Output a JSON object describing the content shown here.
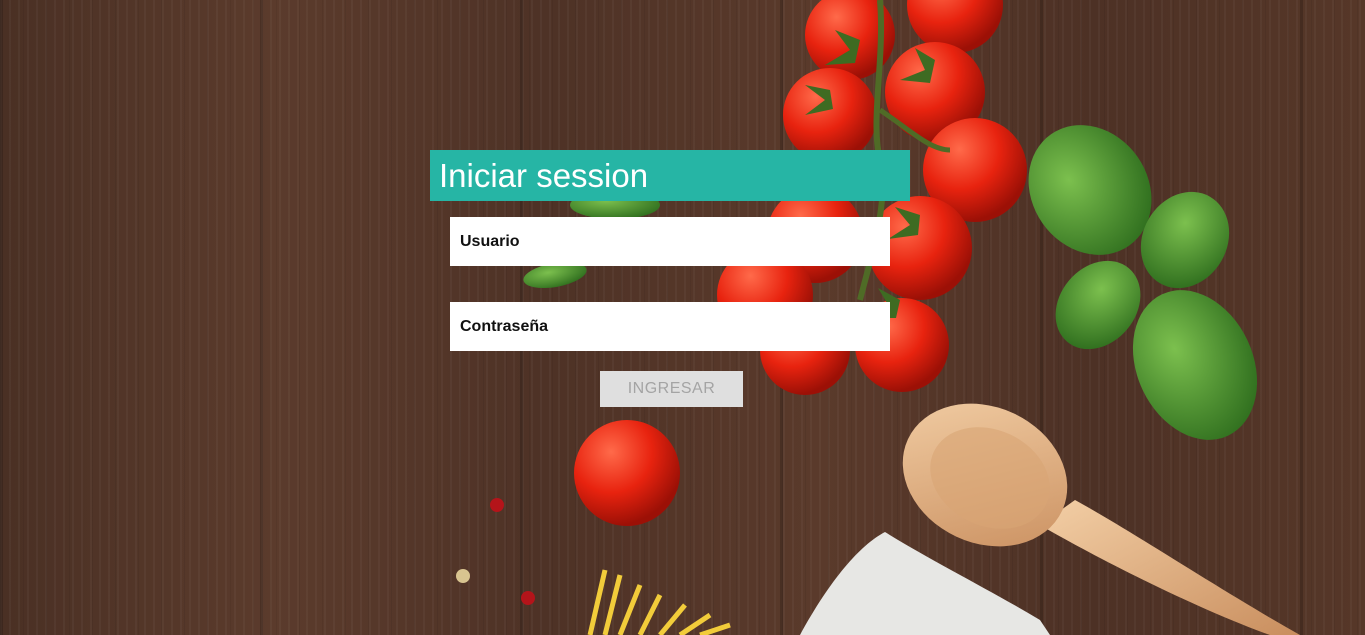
{
  "login": {
    "title": "Iniciar session",
    "username_placeholder": "Usuario",
    "password_placeholder": "Contraseña",
    "submit_label": "INGRESAR"
  },
  "colors": {
    "header": "#26b5a5",
    "button_bg": "#dfdfdf",
    "button_text": "#a4a4a4"
  }
}
